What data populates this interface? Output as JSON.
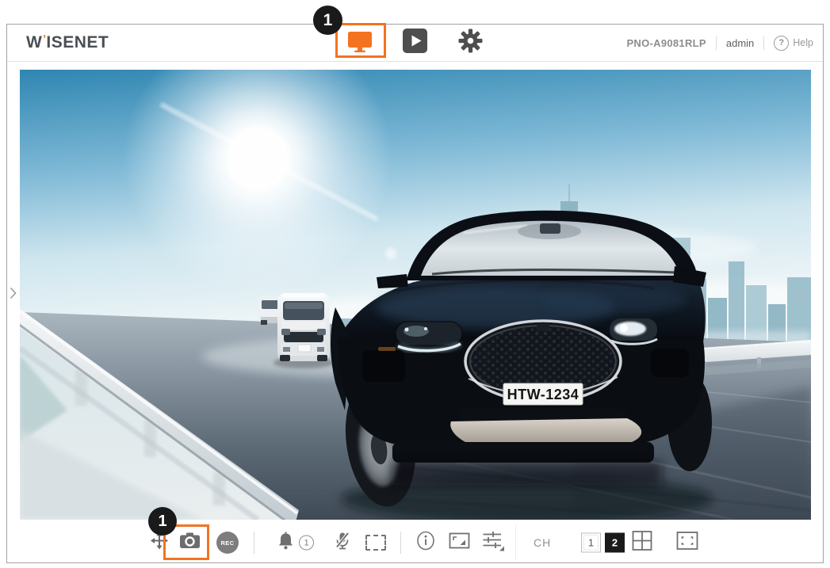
{
  "topbar": {
    "logo_w": "W",
    "logo_mark": "'",
    "logo_rest": "ISENET",
    "device_model": "PNO-A9081RLP",
    "user": "admin",
    "help_glyph": "?",
    "help_label": "Help"
  },
  "annotations": {
    "live_badge": "1",
    "capture_badge": "1"
  },
  "live_view": {
    "license_plate": "HTW-1234"
  },
  "toolbar": {
    "rec_label": "REC",
    "alarm_count": "1",
    "channel_label": "CH",
    "channels": [
      {
        "label": "1",
        "selected": false
      },
      {
        "label": "2",
        "selected": true
      }
    ]
  },
  "colors": {
    "accent_orange": "#F37321",
    "top_nav_icon_gray": "#4E4E4E",
    "toolbar_icon_gray": "#707070",
    "channel_selected_bg": "#1A1A1A",
    "badge_bg": "#1A1A1A"
  },
  "icons": [
    "wisenet-logo",
    "live-view-monitor-icon",
    "playback-icon",
    "settings-gear-icon",
    "help-icon",
    "panel-expand-chevron-icon",
    "pan-tilt-icon",
    "snapshot-camera-icon",
    "rec-icon",
    "alarm-bell-icon",
    "mic-mute-icon",
    "area-select-icon",
    "info-icon",
    "aspect-ratio-icon",
    "image-adjust-icon",
    "grid-layout-icon",
    "fullscreen-icon"
  ]
}
